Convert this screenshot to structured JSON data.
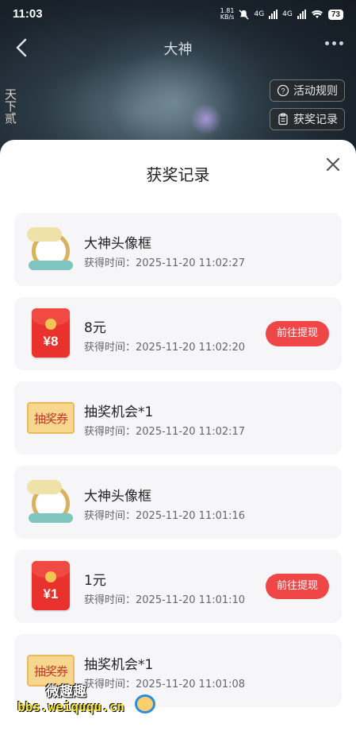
{
  "status_bar": {
    "time": "11:03",
    "net_speed_value": "1.81",
    "net_speed_unit": "KB/s",
    "net1": "4G",
    "net2": "4G",
    "battery": "73"
  },
  "nav": {
    "title": "大神"
  },
  "hero": {
    "calligraphy": "天下贰",
    "rules_label": "活动规则",
    "records_label": "获奖记录"
  },
  "sheet": {
    "title": "获奖记录",
    "items": [
      {
        "name": "大神头像框",
        "time": "获得时间：2025-11-20 11:02:27",
        "icon": "avatar-frame"
      },
      {
        "name": "8元",
        "time": "获得时间：2025-11-20 11:02:20",
        "icon": "red-packet",
        "amount": "¥8",
        "action": "前往提现"
      },
      {
        "name": "抽奖机会*1",
        "time": "获得时间：2025-11-20 11:02:17",
        "icon": "lottery-ticket",
        "ticket_text": "抽奖券"
      },
      {
        "name": "大神头像框",
        "time": "获得时间：2025-11-20 11:01:16",
        "icon": "avatar-frame"
      },
      {
        "name": "1元",
        "time": "获得时间：2025-11-20 11:01:10",
        "icon": "red-packet",
        "amount": "¥1",
        "action": "前往提现"
      },
      {
        "name": "抽奖机会*1",
        "time": "获得时间：2025-11-20 11:01:08",
        "icon": "lottery-ticket",
        "ticket_text": "抽奖券"
      }
    ]
  },
  "watermark": {
    "line1": "微趣趣",
    "line2": "bbs.weiququ.cn"
  },
  "colors": {
    "accent": "#ef4747",
    "card_bg": "#f6f6f8",
    "sheet_bg": "#ffffff"
  }
}
